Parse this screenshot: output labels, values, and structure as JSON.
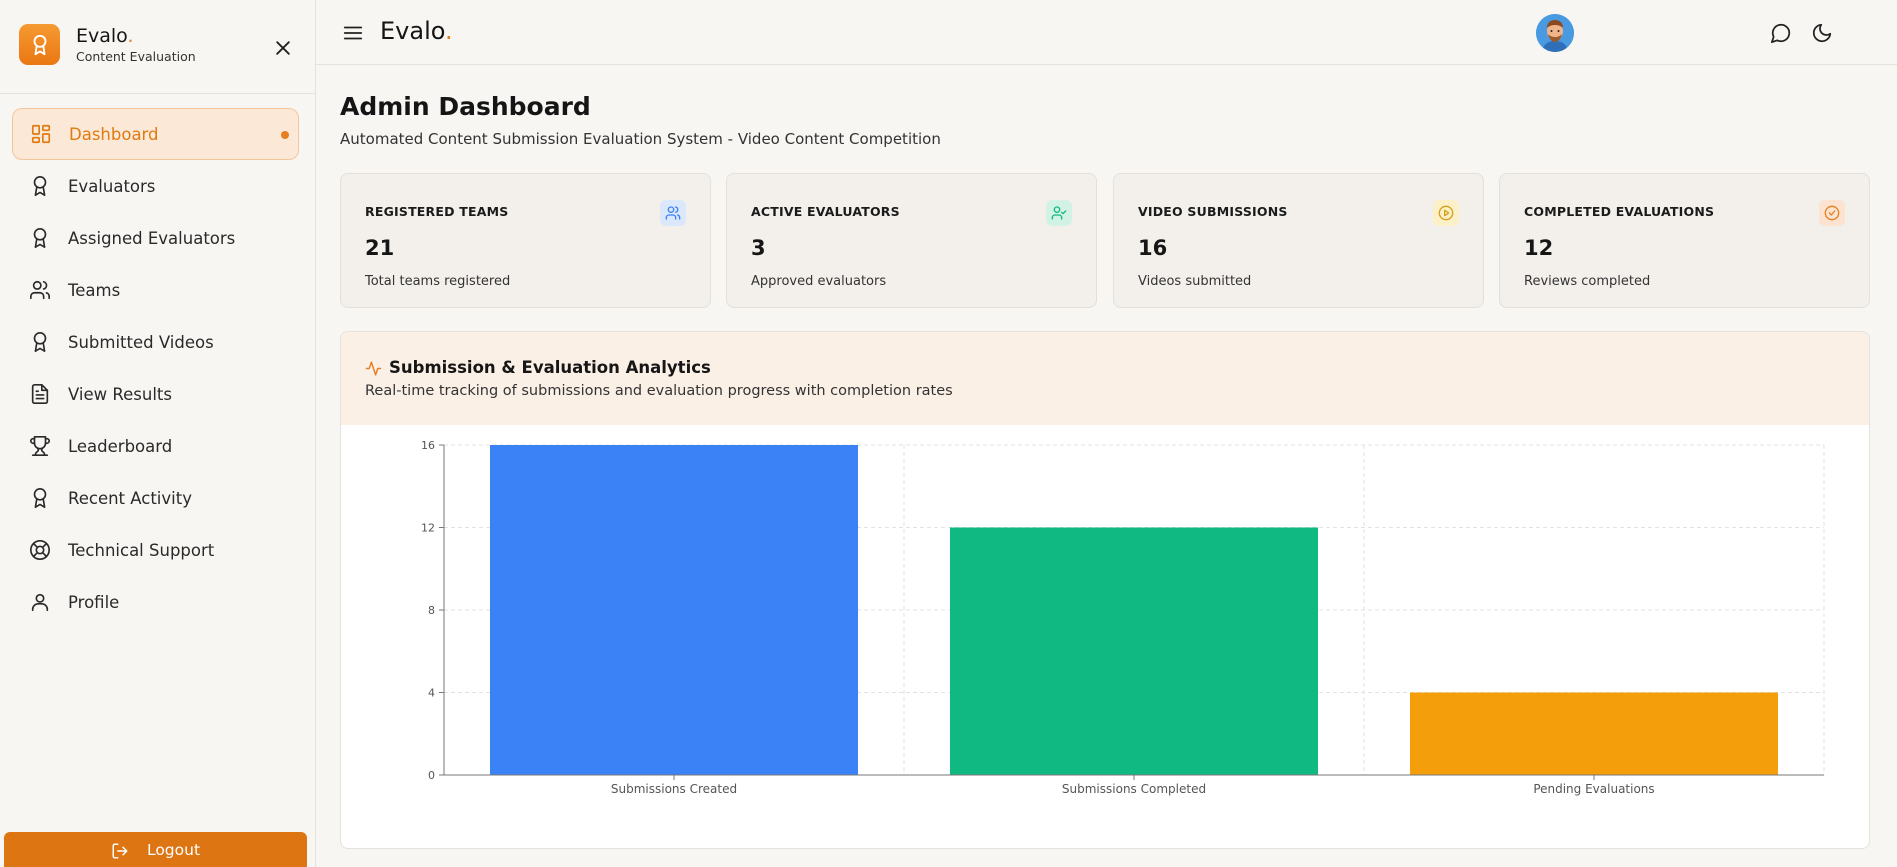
{
  "brand": {
    "name": "Evalo",
    "dot": ".",
    "subtitle": "Content Evaluation"
  },
  "sidebar": {
    "items": [
      {
        "label": "Dashboard",
        "icon": "dashboard-icon",
        "active": true
      },
      {
        "label": "Evaluators",
        "icon": "award-icon"
      },
      {
        "label": "Assigned Evaluators",
        "icon": "award-icon"
      },
      {
        "label": "Teams",
        "icon": "users-icon"
      },
      {
        "label": "Submitted Videos",
        "icon": "award-icon"
      },
      {
        "label": "View Results",
        "icon": "file-text-icon"
      },
      {
        "label": "Leaderboard",
        "icon": "trophy-icon"
      },
      {
        "label": "Recent Activity",
        "icon": "award-icon"
      },
      {
        "label": "Technical Support",
        "icon": "lifebuoy-icon"
      },
      {
        "label": "Profile",
        "icon": "user-icon"
      }
    ],
    "logout_label": "Logout"
  },
  "topbar": {
    "brand": "Evalo",
    "dot": "."
  },
  "page": {
    "title": "Admin Dashboard",
    "subtitle": "Automated Content Submission Evaluation System - Video Content Competition"
  },
  "stats": [
    {
      "label": "REGISTERED TEAMS",
      "value": "21",
      "desc": "Total teams registered",
      "icon": "users-icon",
      "color": "#3b82f6",
      "bg": "#dbe8fb"
    },
    {
      "label": "ACTIVE EVALUATORS",
      "value": "3",
      "desc": "Approved evaluators",
      "icon": "user-check-icon",
      "color": "#10b981",
      "bg": "#d3f2e6"
    },
    {
      "label": "VIDEO SUBMISSIONS",
      "value": "16",
      "desc": "Videos submitted",
      "icon": "play-circle-icon",
      "color": "#d4a017",
      "bg": "#fbf0c8"
    },
    {
      "label": "COMPLETED EVALUATIONS",
      "value": "12",
      "desc": "Reviews completed",
      "icon": "check-circle-icon",
      "color": "#e67e22",
      "bg": "#fbe3cf"
    }
  ],
  "analytics": {
    "title": "Submission & Evaluation Analytics",
    "subtitle": "Real-time tracking of submissions and evaluation progress with completion rates"
  },
  "chart_data": {
    "type": "bar",
    "categories": [
      "Submissions Created",
      "Submissions Completed",
      "Pending Evaluations"
    ],
    "values": [
      16,
      12,
      4
    ],
    "colors": [
      "#3b82f6",
      "#10b981",
      "#f59e0b"
    ],
    "ylim": [
      0,
      16
    ],
    "yticks": [
      0,
      4,
      8,
      12,
      16
    ],
    "grid": true
  },
  "colors": {
    "accent": "#e67e22"
  }
}
